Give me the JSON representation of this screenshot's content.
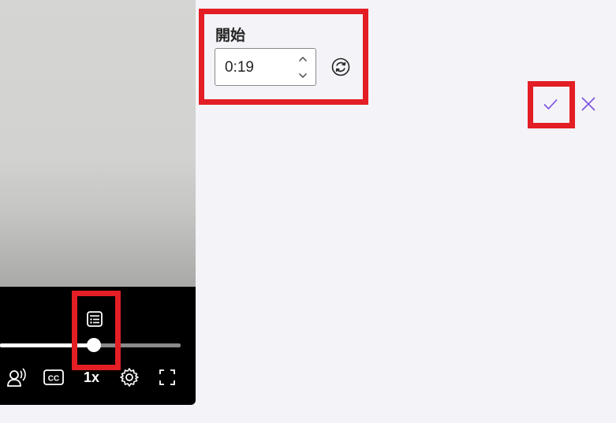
{
  "player": {
    "progress_percent": 52,
    "speed_label": "1x",
    "icons": {
      "chapters": "chapters-list-icon",
      "audio": "audio-description-icon",
      "captions": "closed-captions-icon",
      "settings": "gear-icon",
      "fullscreen": "fullscreen-icon"
    },
    "captions_label": "CC"
  },
  "editor": {
    "start_label": "開始",
    "start_time_value": "0:19",
    "icons": {
      "spin_up": "chevron-up-icon",
      "spin_down": "chevron-down-icon",
      "refresh": "refresh-icon",
      "confirm": "checkmark-icon",
      "cancel": "close-icon"
    }
  },
  "colors": {
    "highlight": "#e31e24",
    "accent": "#7b4fe0",
    "background": "#f4f3f8"
  }
}
